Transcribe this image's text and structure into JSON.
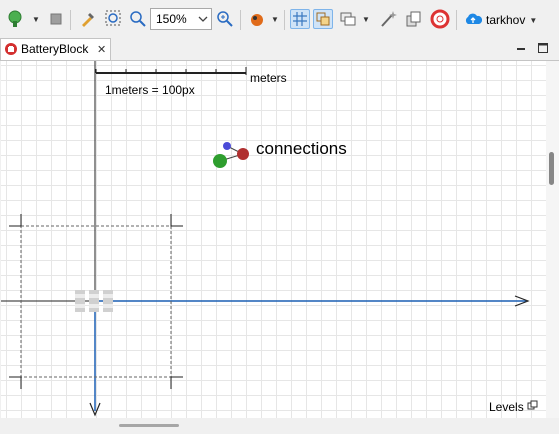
{
  "toolbar": {
    "zoom_value": "150%",
    "user_name": "tarkhov",
    "icons": [
      "run-icon",
      "stop-icon",
      "build-icon",
      "zoom-fit-icon",
      "zoom-region-icon",
      "zoom-in-icon",
      "color-icon",
      "grid-icon",
      "snap-icon",
      "shapes-icon",
      "wand-icon",
      "layers-icon",
      "help-icon",
      "cloud-icon"
    ]
  },
  "tab": {
    "label": "BatteryBlock"
  },
  "canvas": {
    "scale_unit": "meters",
    "scale_note": "1meters = 100px",
    "connections_label": "connections",
    "levels_label": "Levels",
    "accent_color": "#1a5fb4"
  }
}
